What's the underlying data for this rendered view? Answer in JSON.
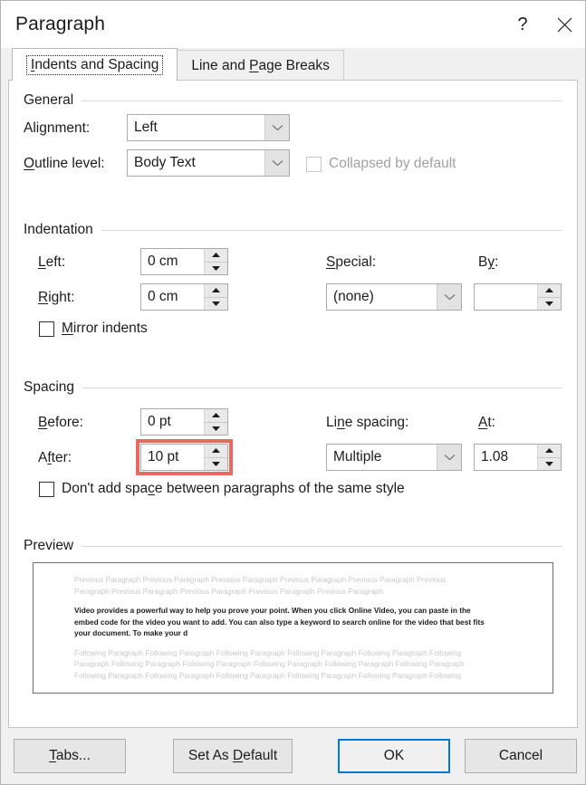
{
  "dialog": {
    "title": "Paragraph",
    "help_icon": "question-mark-icon",
    "close_icon": "close-icon"
  },
  "tabs": [
    {
      "label": "Indents and Spacing",
      "accel": "I",
      "active": true
    },
    {
      "label": "Line and Page Breaks",
      "accel": "P",
      "active": false
    }
  ],
  "general": {
    "heading": "General",
    "alignment_label": "Alignment:",
    "alignment_value": "Left",
    "outline_label": "Outline level:",
    "outline_accel": "O",
    "outline_value": "Body Text",
    "collapsed_label": "Collapsed by default",
    "collapsed_checked": false,
    "collapsed_disabled": true
  },
  "indentation": {
    "heading": "Indentation",
    "left_label": "Left:",
    "left_accel": "L",
    "left_value": "0 cm",
    "right_label": "Right:",
    "right_accel": "R",
    "right_value": "0 cm",
    "special_label": "Special:",
    "special_accel": "S",
    "special_value": "(none)",
    "by_label": "By:",
    "by_accel": "y",
    "by_value": "",
    "mirror_label": "Mirror indents",
    "mirror_accel": "M",
    "mirror_checked": false
  },
  "spacing": {
    "heading": "Spacing",
    "before_label": "Before:",
    "before_accel": "B",
    "before_value": "0 pt",
    "after_label": "After:",
    "after_accel": "f",
    "after_value": "10 pt",
    "after_highlighted": true,
    "highlight_color": "#e8695e",
    "line_spacing_label": "Line spacing:",
    "line_spacing_accel": "n",
    "line_spacing_value": "Multiple",
    "at_label": "At:",
    "at_accel": "A",
    "at_value": "1.08",
    "dont_add_label": "Don't add space between paragraphs of the same style",
    "dont_add_checked": false
  },
  "preview": {
    "heading": "Preview",
    "before_lines": [
      "Previous Paragraph Previous Paragraph Previous Paragraph Previous Paragraph Previous Paragraph Previous",
      "Paragraph Previous Paragraph Previous Paragraph Previous Paragraph Previous Paragraph"
    ],
    "body_lines": [
      "Video provides a powerful way to help you prove your point. When you click Online Video, you can paste in the",
      "embed code for the video you want to add. You can also type a keyword to search online for the video that best fits",
      "your document. To make your d"
    ],
    "after_lines": [
      "Following Paragraph Following Paragraph Following Paragraph Following Paragraph Following Paragraph Following",
      "Paragraph Following Paragraph Following Paragraph Following Paragraph Following Paragraph Following Paragraph",
      "Following Paragraph Following Paragraph Following Paragraph Following Paragraph Following Paragraph Following"
    ]
  },
  "footer": {
    "tabs_button": "Tabs...",
    "tabs_accel": "T",
    "set_default_button": "Set As Default",
    "set_default_accel": "D",
    "ok_button": "OK",
    "cancel_button": "Cancel",
    "default_button": "OK",
    "focus_color": "#0078d7"
  }
}
